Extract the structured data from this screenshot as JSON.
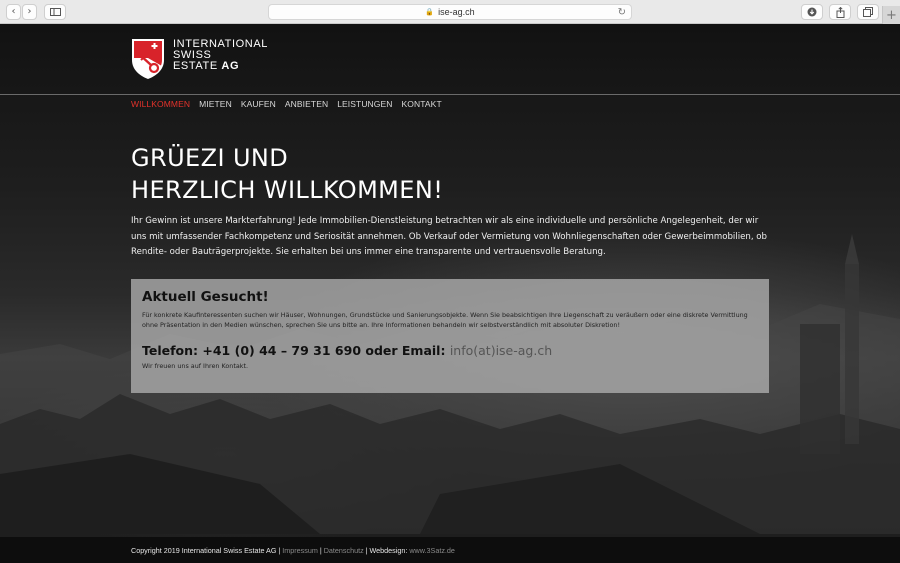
{
  "browser": {
    "url": "ise-ag.ch"
  },
  "logo": {
    "line1": "INTERNATIONAL",
    "line2": "SWISS",
    "line3": "ESTATE",
    "line3_bold": "AG"
  },
  "nav": {
    "items": [
      {
        "label": "WILLKOMMEN",
        "active": true
      },
      {
        "label": "MIETEN"
      },
      {
        "label": "KAUFEN"
      },
      {
        "label": "ANBIETEN"
      },
      {
        "label": "LEISTUNGEN"
      },
      {
        "label": "KONTAKT"
      }
    ]
  },
  "hero": {
    "title_line1": "GRÜEZI UND",
    "title_line2": "HERZLICH WILLKOMMEN!",
    "text": "Ihr Gewinn ist unsere Markterfahrung! Jede Immobilien-Dienstleistung betrachten wir als eine individuelle und persönliche Angelegenheit, der wir uns mit umfassender Fachkompetenz und Seriosität annehmen. Ob Verkauf oder Vermietung von Wohnliegenschaften oder Gewerbeimmobilien, ob Rendite- oder Bauträgerprojekte. Sie erhalten bei uns immer eine transparente und vertrauensvolle Beratung."
  },
  "box": {
    "title": "Aktuell Gesucht!",
    "description": "Für konkrete Kaufinteressenten suchen wir Häuser, Wohnungen, Grundstücke und Sanierungsobjekte. Wenn Sie beabsichtigen Ihre Liegenschaft zu veräußern oder eine diskrete Vermittlung ohne Präsentation in den Medien wünschen, sprechen Sie uns bitte an. Ihre Informationen behandeln wir selbstverständlich mit absoluter Diskretion!",
    "phone_line": "Telefon: +41 (0) 44 – 79 31 690 oder Email: ",
    "email": "info(at)ise-ag.ch",
    "thanks": "Wir freuen uns auf Ihren Kontakt."
  },
  "footer": {
    "copyright": "Copyright 2019 International Swiss Estate AG | ",
    "impressum": "Impressum",
    "sep1": " | ",
    "datenschutz": "Datenschutz",
    "sep2": " | Webdesign: ",
    "webdesign": "www.3Satz.de"
  },
  "colors": {
    "accent_red": "#e3322b",
    "box_gray": "#aaaaaa"
  }
}
